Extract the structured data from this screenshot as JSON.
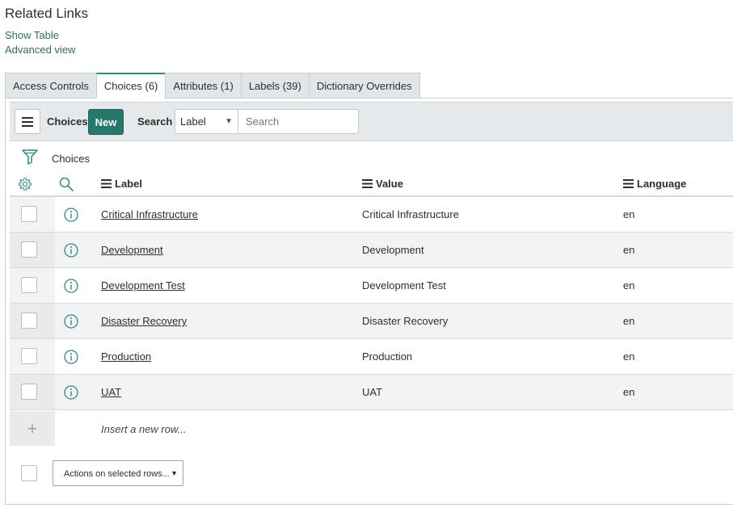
{
  "related_links": {
    "title": "Related Links",
    "links": [
      "Show Table",
      "Advanced view"
    ]
  },
  "tabs": [
    {
      "label": "Access Controls",
      "active": false
    },
    {
      "label": "Choices (6)",
      "active": true
    },
    {
      "label": "Attributes (1)",
      "active": false
    },
    {
      "label": "Labels (39)",
      "active": false
    },
    {
      "label": "Dictionary Overrides",
      "active": false
    }
  ],
  "toolbar": {
    "list_title": "Choices",
    "new_label": "New",
    "search_label": "Search",
    "search_field_selected": "Label",
    "search_placeholder": "Search"
  },
  "breadcrumb": "Choices",
  "columns": {
    "label": "Label",
    "value": "Value",
    "language": "Language"
  },
  "rows": [
    {
      "label": "Critical Infrastructure",
      "value": "Critical Infrastructure",
      "language": "en"
    },
    {
      "label": "Development",
      "value": "Development",
      "language": "en"
    },
    {
      "label": "Development Test",
      "value": "Development Test",
      "language": "en"
    },
    {
      "label": "Disaster Recovery",
      "value": "Disaster Recovery",
      "language": "en"
    },
    {
      "label": "Production",
      "value": "Production",
      "language": "en"
    },
    {
      "label": "UAT",
      "value": "UAT",
      "language": "en"
    }
  ],
  "insert_row_text": "Insert a new row...",
  "actions_select": "Actions on selected rows...",
  "colors": {
    "accent": "#27786c",
    "link": "#2c6e6a",
    "icon": "#2c8c7e"
  }
}
